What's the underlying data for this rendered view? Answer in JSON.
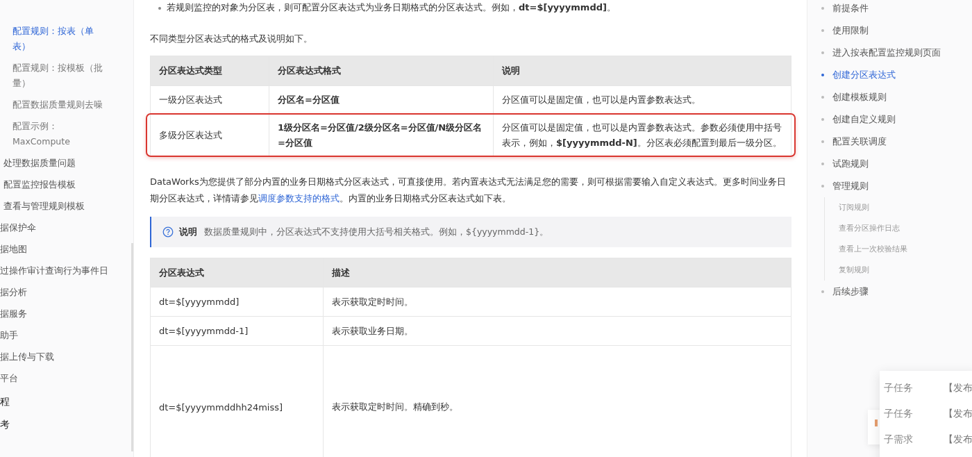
{
  "sidebar": {
    "items": [
      {
        "label": "配置规则：按表（单表）",
        "kind": "sub",
        "selected": true
      },
      {
        "label": "配置规则：按模板（批量）",
        "kind": "sub",
        "selected": false
      },
      {
        "label": "配置数据质量规则去噪",
        "kind": "sub",
        "selected": false
      },
      {
        "label": "配置示例：MaxCompute",
        "kind": "sub",
        "selected": false
      },
      {
        "label": "处理数据质量问题",
        "kind": "item",
        "selected": false
      },
      {
        "label": "配置监控报告模板",
        "kind": "item",
        "selected": false
      },
      {
        "label": "查看与管理规则模板",
        "kind": "item",
        "selected": false
      },
      {
        "label": "据保护伞",
        "kind": "cut",
        "selected": false
      },
      {
        "label": "据地图",
        "kind": "cut",
        "selected": false
      },
      {
        "label": "过操作审计查询行为事件日",
        "kind": "cut",
        "selected": false
      },
      {
        "label": "据分析",
        "kind": "cut",
        "selected": false
      },
      {
        "label": "据服务",
        "kind": "cut",
        "selected": false
      },
      {
        "label": "助手",
        "kind": "cut",
        "selected": false
      },
      {
        "label": "据上传与下载",
        "kind": "cut",
        "selected": false
      },
      {
        "label": "平台",
        "kind": "cut",
        "selected": false
      },
      {
        "label": "程",
        "kind": "top",
        "selected": false
      },
      {
        "label": "考",
        "kind": "top",
        "selected": false
      }
    ]
  },
  "article": {
    "bullet": "若规则监控的对象为分区表，则可配置分区表达式为业务日期格式的分区表达式。例如，**dt=$[yyyymmdd]**。",
    "intro": "不同类型分区表达式的格式及说明如下。",
    "table_1": {
      "columns": [
        "分区表达式类型",
        "分区表达式格式",
        "说明"
      ],
      "rows": [
        {
          "type": "一级分区表达式",
          "format": "分区名=分区值",
          "description": "分区值可以是固定值，也可以是内置参数表达式。",
          "highlighted": false
        },
        {
          "type": "多级分区表达式",
          "format": "1级分区名=分区值/2级分区名=分区值/N级分区名=分区值",
          "description": "分区值可以是固定值，也可以是内置参数表达式。参数必须使用中括号表示，例如，**$[yyyymmdd-N]**。分区表必须配置到最后一级分区。",
          "highlighted": true
        }
      ]
    },
    "paragraph": {
      "before": "DataWorks为您提供了部分内置的业务日期格式分区表达式，可直接使用。若内置表达式无法满足您的需要，则可根据需要输入自定义表达式。更多时间业务日期分区表达式，详情请参见",
      "link": "调度参数支持的格式",
      "after": "。内置的业务日期格式分区表达式如下表。"
    },
    "note": {
      "label": "说明",
      "text": "数据质量规则中，分区表达式不支持使用大括号相关格式。例如，${yyyymmdd-1}。"
    },
    "table_2": {
      "columns": [
        "分区表达式",
        "描述"
      ],
      "rows": [
        {
          "expression": "dt=$[yyyymmdd]",
          "description": "表示获取定时时间。",
          "tall": false
        },
        {
          "expression": "dt=$[yyyymmdd-1]",
          "description": "表示获取业务日期。",
          "tall": false
        },
        {
          "expression": "dt=$[yyyymmddhh24miss]",
          "description": "表示获取定时时间。精确到秒。",
          "tall": true
        }
      ]
    }
  },
  "toc": {
    "items": [
      {
        "label": "前提条件",
        "selected": false
      },
      {
        "label": "使用限制",
        "selected": false
      },
      {
        "label": "进入按表配置监控规则页面",
        "selected": false
      },
      {
        "label": "创建分区表达式",
        "selected": true
      },
      {
        "label": "创建模板规则",
        "selected": false
      },
      {
        "label": "创建自定义规则",
        "selected": false
      },
      {
        "label": "配置关联调度",
        "selected": false
      },
      {
        "label": "试跑规则",
        "selected": false
      },
      {
        "label": "管理规则",
        "selected": false,
        "children": [
          {
            "label": "订阅规则",
            "selected": false
          },
          {
            "label": "查看分区操作日志",
            "selected": false
          },
          {
            "label": "查看上一次校验结果",
            "selected": false
          },
          {
            "label": "复制规则",
            "selected": false
          }
        ]
      },
      {
        "label": "后续步骤",
        "selected": false
      }
    ]
  },
  "popup": {
    "rows": [
      {
        "type": "子任务",
        "status": "【发布"
      },
      {
        "type": "子任务",
        "status": "【发布"
      },
      {
        "type": "子需求",
        "status": "【发布"
      }
    ]
  }
}
